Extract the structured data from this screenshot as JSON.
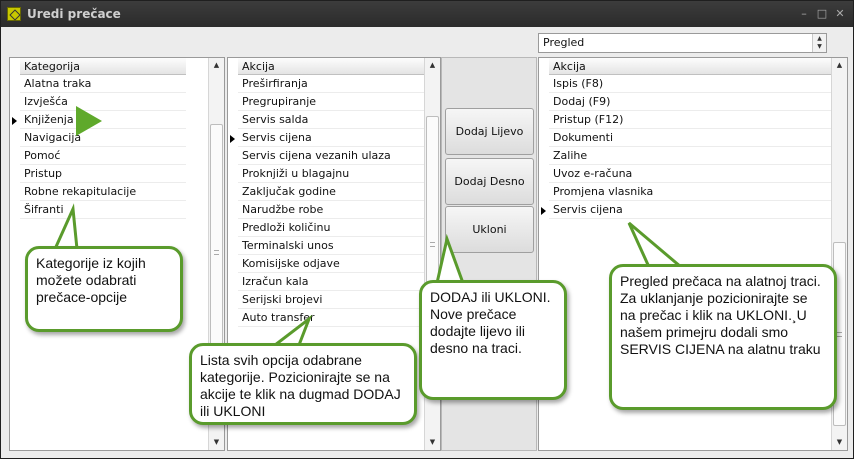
{
  "window": {
    "title": "Uredi prečace",
    "controls": [
      "–",
      "□",
      "✕"
    ]
  },
  "view_select": {
    "value": "Pregled"
  },
  "categories": {
    "header": "Kategorija",
    "items": [
      "Alatna traka",
      "Izvješća",
      "Knjiženja",
      "Navigacija",
      "Pomoć",
      "Pristup",
      "Robne rekapitulacije",
      "Šifranti"
    ],
    "selected_index": 2
  },
  "actions": {
    "header": "Akcija",
    "items": [
      "Preširfiranja",
      "Pregrupiranje",
      "Servis salda",
      "Servis cijena",
      "Servis cijena vezanih ulaza",
      "Proknjiži u blagajnu",
      "Zaključak godine",
      "Narudžbe robe",
      "Predloži količinu",
      "Terminalski unos",
      "Komisijske odjave",
      "Izračun kala",
      "Serijski brojevi",
      "Auto transfer"
    ],
    "selected_index": 3
  },
  "buttons": {
    "add_left": "Dodaj Lijevo",
    "add_right": "Dodaj Desno",
    "remove": "Ukloni"
  },
  "preview": {
    "header": "Akcija",
    "items": [
      "Ispis (F8)",
      "Dodaj (F9)",
      "Pristup (F12)",
      "Dokumenti",
      "Zalihe",
      "Uvoz e-računa",
      "Promjena vlasnika",
      "Servis cijena"
    ],
    "selected_index": 7
  },
  "callouts": {
    "categories": "Kategorije iz kojih možete odabrati prečace-opcije",
    "actions": "Lista svih opcija odabrane kategorije. Pozicionirajte se na akcije te klik na dugmad DODAJ ili UKLONI",
    "buttons": "DODAJ ili UKLONI. Nove prečace dodajte lijevo ili desno na traci.",
    "preview": "Pregled prečaca na alatnoj traci. Za uklanjanje pozicionirajte se na prečac i klik na UKLONI.¸U našem primejru dodali smo SERVIS CIJENA na alatnu traku"
  },
  "colors": {
    "callout_border": "#5a9b2c",
    "arrow": "#5fa92b",
    "titlebar": "#2b2b2b"
  },
  "icons": [
    "app-icon",
    "minimize-icon",
    "maximize-icon",
    "close-icon",
    "select-arrows-icon",
    "scroll-up-icon",
    "scroll-down-icon",
    "row-marker-icon",
    "pointer-arrow-icon"
  ]
}
